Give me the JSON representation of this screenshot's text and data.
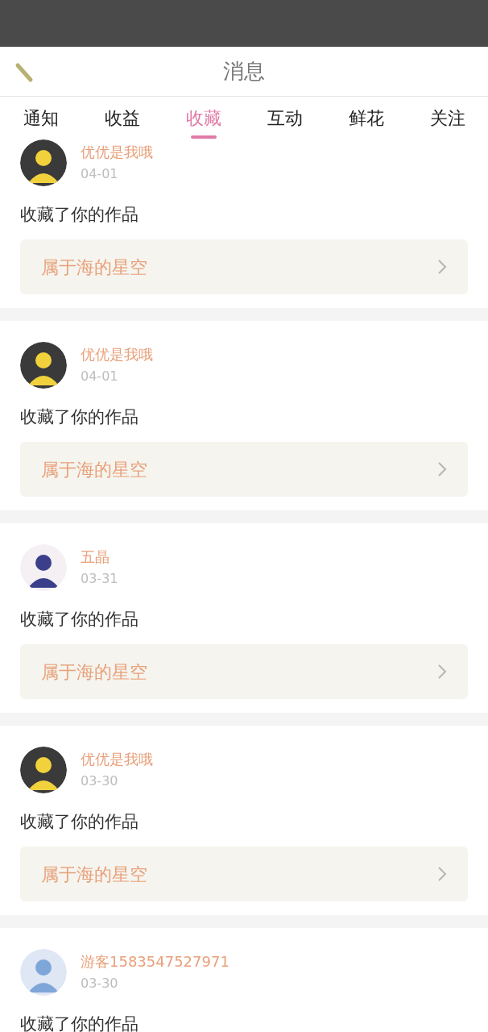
{
  "header": {
    "title": "消息"
  },
  "tabs": [
    {
      "label": "通知",
      "selected": false
    },
    {
      "label": "收益",
      "selected": false
    },
    {
      "label": "收藏",
      "selected": true
    },
    {
      "label": "互动",
      "selected": false
    },
    {
      "label": "鲜花",
      "selected": false
    },
    {
      "label": "关注",
      "selected": false
    }
  ],
  "messages": [
    {
      "user": "优优是我哦",
      "date": "04-01",
      "text": "收藏了你的作品",
      "work": "属于海的星空"
    },
    {
      "user": "优优是我哦",
      "date": "04-01",
      "text": "收藏了你的作品",
      "work": "属于海的星空"
    },
    {
      "user": "五晶",
      "date": "03-31",
      "text": "收藏了你的作品",
      "work": "属于海的星空"
    },
    {
      "user": "优优是我哦",
      "date": "03-30",
      "text": "收藏了你的作品",
      "work": "属于海的星空"
    },
    {
      "user": "游客1583547527971",
      "date": "03-30",
      "text": "收藏了你的作品"
    }
  ]
}
